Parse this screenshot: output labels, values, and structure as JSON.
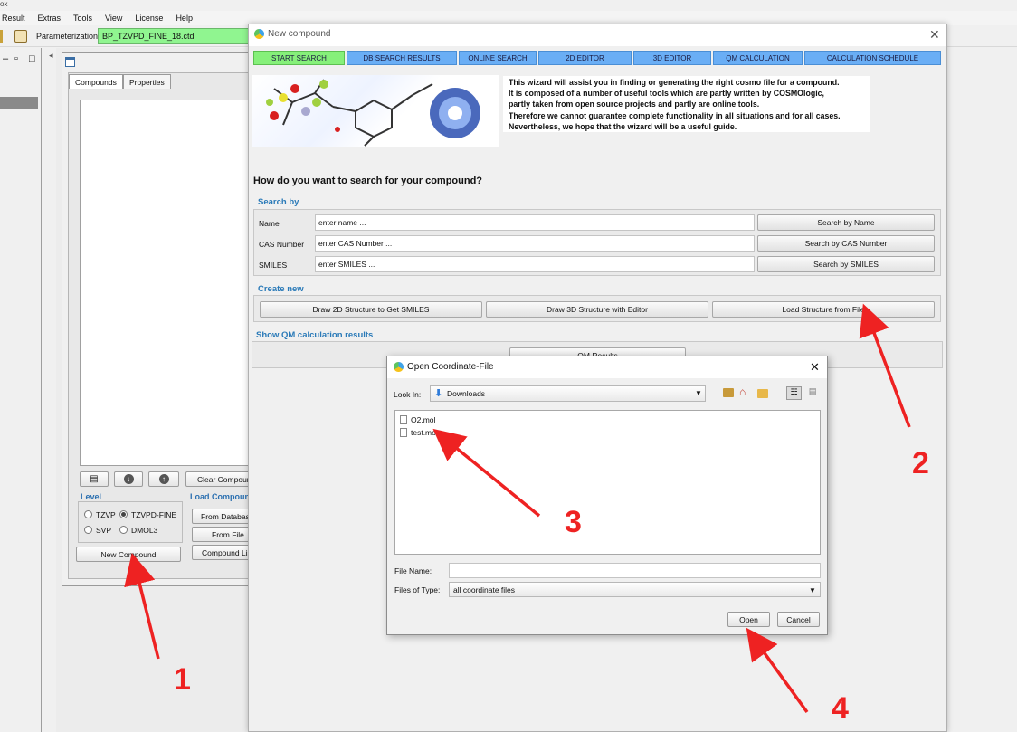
{
  "menubar": {
    "items": [
      "Result",
      "Extras",
      "Tools",
      "View",
      "License",
      "Help"
    ],
    "top_fragment": "ox"
  },
  "toolbar": {
    "param_label": "Parameterization:",
    "param_value": "BP_TZVPD_FINE_18.ctd"
  },
  "left_panel": {
    "tabs": [
      "Compounds",
      "Properties"
    ],
    "buttons": {
      "clear": "Clear Compounds",
      "new_compound": "New Compound",
      "from_database": "From Database",
      "from_file": "From File",
      "compound_list": "Compound List"
    },
    "level_title": "Level",
    "load_title": "Load Compounds",
    "levels": [
      {
        "label": "TZVP",
        "selected": false
      },
      {
        "label": "TZVPD-FINE",
        "selected": true
      },
      {
        "label": "SVP",
        "selected": false
      },
      {
        "label": "DMOL3",
        "selected": false
      }
    ]
  },
  "wizard": {
    "title": "New compound",
    "tabs": [
      {
        "label": "START SEARCH",
        "active": true
      },
      {
        "label": "DB SEARCH RESULTS",
        "active": false
      },
      {
        "label": "ONLINE SEARCH",
        "active": false
      },
      {
        "label": "2D EDITOR",
        "active": false
      },
      {
        "label": "3D EDITOR",
        "active": false
      },
      {
        "label": "QM CALCULATION",
        "active": false
      },
      {
        "label": "CALCULATION SCHEDULE",
        "active": false
      }
    ],
    "intro_lines": [
      "This wizard will assist you in finding or generating the right cosmo file for a compound.",
      "It is composed of a number of useful tools which are partly written by COSMOlogic,",
      "partly taken from open source projects and partly are online tools.",
      "Therefore we cannot guarantee complete functionality in all situations and for all cases.",
      "Nevertheless, we hope that the wizard will be a useful guide."
    ],
    "question": "How do you want to search for your compound?",
    "search_by": {
      "title": "Search by",
      "rows": [
        {
          "label": "Name",
          "placeholder": "enter name ...",
          "button": "Search by Name"
        },
        {
          "label": "CAS Number",
          "placeholder": "enter CAS Number ...",
          "button": "Search by CAS Number"
        },
        {
          "label": "SMILES",
          "placeholder": "enter SMILES ...",
          "button": "Search by SMILES"
        }
      ]
    },
    "create_new": {
      "title": "Create new",
      "buttons": [
        "Draw 2D Structure to Get SMILES",
        "Draw 3D Structure with Editor",
        "Load Structure from File"
      ]
    },
    "qm_results": {
      "title": "Show QM calculation results",
      "button": "QM Results"
    }
  },
  "file_dialog": {
    "title": "Open Coordinate-File",
    "look_in_label": "Look In:",
    "look_in_value": "Downloads",
    "files": [
      "O2.mol",
      "test.mol"
    ],
    "file_name_label": "File Name:",
    "file_name_value": "",
    "files_of_type_label": "Files of Type:",
    "files_of_type_value": "all coordinate files",
    "open_button": "Open",
    "cancel_button": "Cancel"
  },
  "annotations": {
    "step_numbers": [
      "1",
      "2",
      "3",
      "4"
    ],
    "color": "#ee2222"
  }
}
